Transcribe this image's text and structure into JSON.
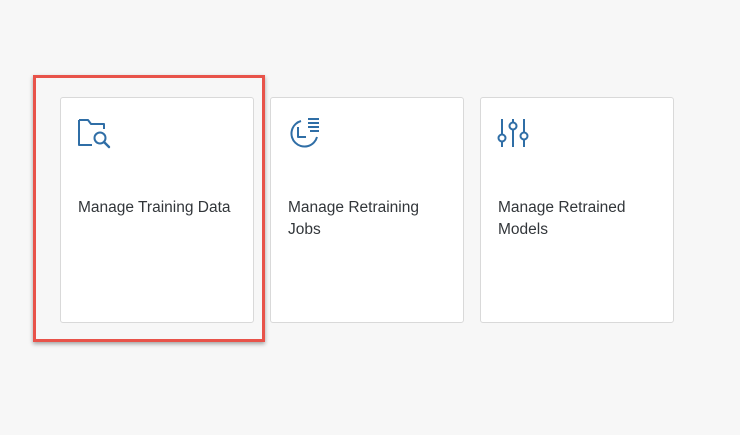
{
  "colors": {
    "background": "#f7f7f7",
    "tile_background": "#ffffff",
    "tile_border": "#d9d9d9",
    "icon_color": "#2f6ea6",
    "text_color": "#32363a",
    "highlight_border": "#e8534a"
  },
  "tiles": [
    {
      "title": "Manage Training Data",
      "icon": "folder-search-icon",
      "highlighted": true
    },
    {
      "title": "Manage Retraining Jobs",
      "icon": "job-timeline-icon",
      "highlighted": false
    },
    {
      "title": "Manage Retrained Models",
      "icon": "sliders-icon",
      "highlighted": false
    }
  ]
}
